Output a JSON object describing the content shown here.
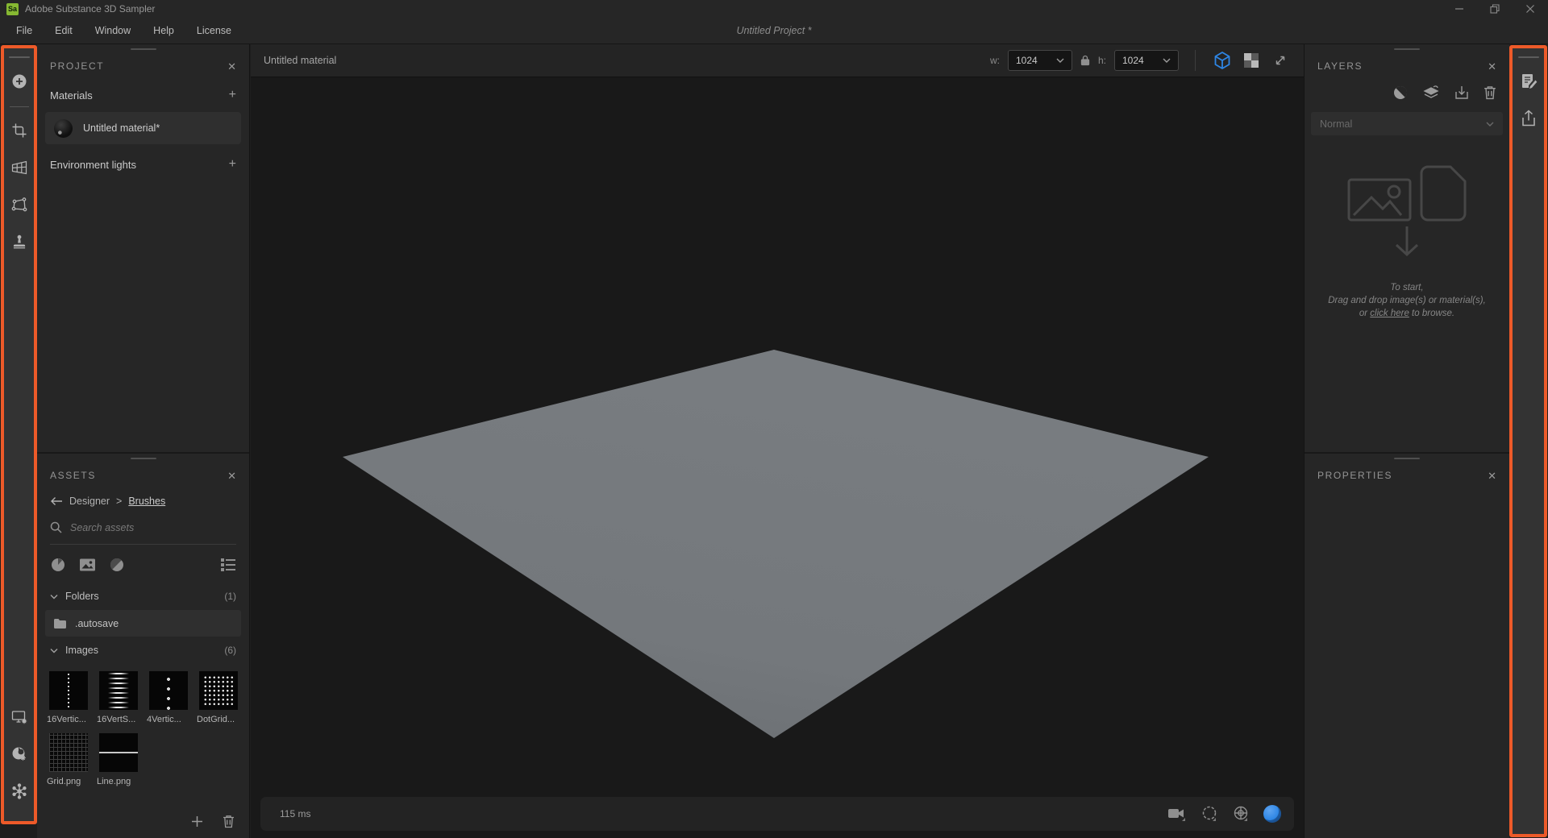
{
  "titlebar": {
    "logo_text": "Sa",
    "app_title": "Adobe Substance 3D Sampler",
    "project_title": "Untitled Project *"
  },
  "menubar": {
    "items": [
      "File",
      "Edit",
      "Window",
      "Help",
      "License"
    ]
  },
  "icons_text": {
    "close": "✕",
    "add": "+"
  },
  "project_panel": {
    "title": "PROJECT",
    "materials_label": "Materials",
    "material_name": "Untitled material*",
    "environment_label": "Environment lights"
  },
  "assets_panel": {
    "title": "ASSETS",
    "breadcrumb_parent": "Designer",
    "breadcrumb_sep": ">",
    "breadcrumb_current": "Brushes",
    "search_placeholder": "Search assets",
    "folders_label": "Folders",
    "folders_count": "(1)",
    "folder_items": [
      ".autosave"
    ],
    "images_label": "Images",
    "images_count": "(6)",
    "image_items": [
      "16Vertic...",
      "16VertS...",
      "4Vertic...",
      "DotGrid...",
      "Grid.png",
      "Line.png"
    ]
  },
  "viewport": {
    "tab_label": "Untitled material",
    "w_label": "w:",
    "w_value": "1024",
    "h_label": "h:",
    "h_value": "1024",
    "render_time": "115 ms"
  },
  "layers_panel": {
    "title": "LAYERS",
    "blend_mode": "Normal",
    "dropzone_line1": "To start,",
    "dropzone_line2": "Drag and drop image(s) or material(s),",
    "dropzone_line3_pre": "or ",
    "dropzone_link": "click here",
    "dropzone_line3_post": " to browse."
  },
  "properties_panel": {
    "title": "PROPERTIES"
  },
  "colors": {
    "highlight_orange": "#ED5A29",
    "accent_blue": "#2E86E5",
    "plane_gray": "#75797d"
  }
}
